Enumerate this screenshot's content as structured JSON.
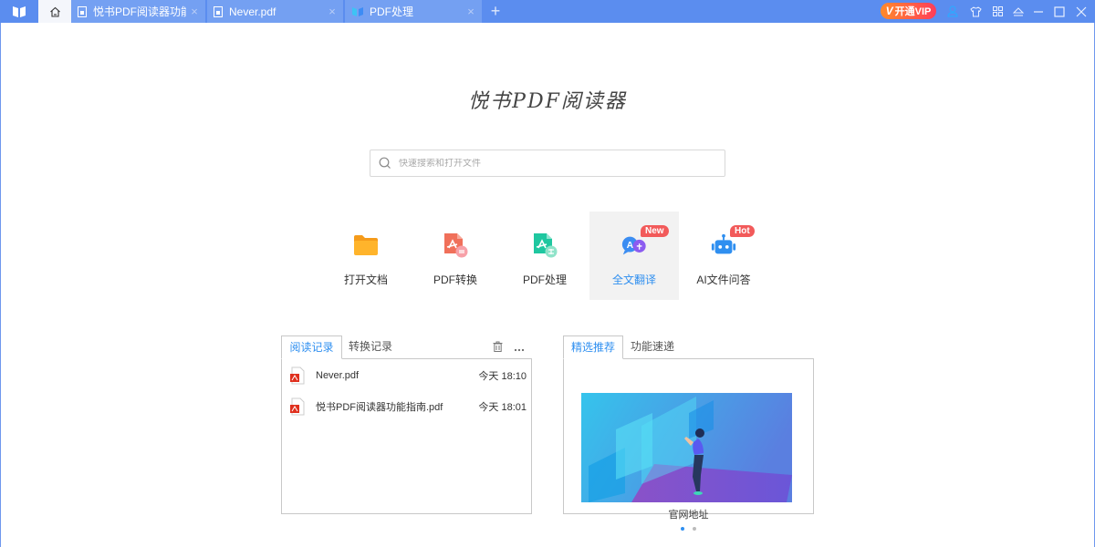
{
  "titlebar": {
    "logo_icon": "book-icon",
    "tabs": [
      {
        "label": "",
        "icon": "home-icon",
        "active": true
      },
      {
        "label": "悦书PDF阅读器功能指...",
        "icon": "pdf-file-icon",
        "close": "×"
      },
      {
        "label": "Never.pdf",
        "icon": "pdf-file-icon",
        "close": "×"
      },
      {
        "label": "PDF处理",
        "icon": "book-icon",
        "close": "×"
      }
    ],
    "new_tab": "+",
    "vip_label": "开通VIP",
    "vip_mark": "V",
    "window_buttons": [
      "user-icon",
      "shirt-icon",
      "apps-icon",
      "collapse-icon",
      "minimize-icon",
      "maximize-icon",
      "close-icon"
    ]
  },
  "main": {
    "app_title": "悦书PDF阅读器",
    "search": {
      "placeholder": "快速搜索和打开文件",
      "value": ""
    },
    "features": [
      {
        "label": "打开文档",
        "icon": "folder-icon"
      },
      {
        "label": "PDF转换",
        "icon": "pdf-convert-icon"
      },
      {
        "label": "PDF处理",
        "icon": "pdf-process-icon"
      },
      {
        "label": "全文翻译",
        "icon": "translate-icon",
        "badge": "New",
        "active": true
      },
      {
        "label": "AI文件问答",
        "icon": "robot-icon",
        "badge": "Hot"
      }
    ]
  },
  "recent": {
    "tabs": [
      "阅读记录",
      "转换记录"
    ],
    "active_tab": 0,
    "files": [
      {
        "name": "Never.pdf",
        "time": "今天 18:10"
      },
      {
        "name": "悦书PDF阅读器功能指南.pdf",
        "time": "今天 18:01"
      }
    ]
  },
  "recommend": {
    "tabs": [
      "精选推荐",
      "功能速递"
    ],
    "active_tab": 0,
    "caption": "官网地址",
    "slides": 2,
    "current_slide": 1
  },
  "colors": {
    "titlebar": "#5b8def",
    "accent": "#2f8ff0",
    "badge": "#f25a5a"
  }
}
